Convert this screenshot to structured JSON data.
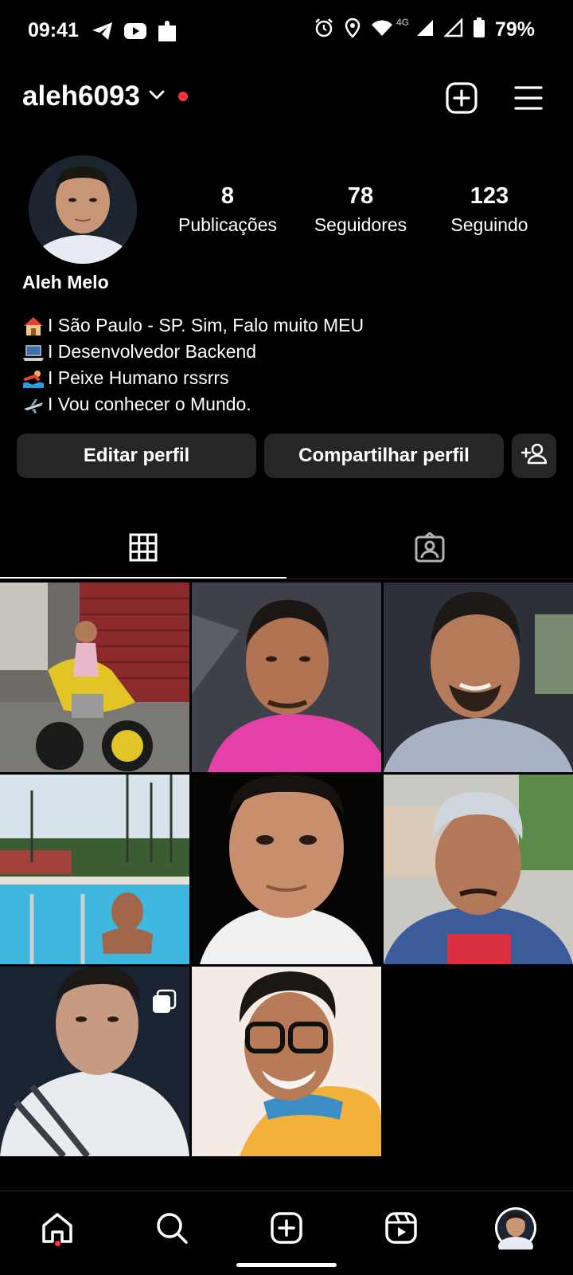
{
  "status_bar": {
    "time": "09:41",
    "network": "4G",
    "battery": "79%",
    "icons": [
      "telegram-icon",
      "youtube-icon",
      "puzzle-icon",
      "alarm-icon",
      "location-icon",
      "wifi-icon",
      "signal-icon",
      "battery-icon"
    ]
  },
  "header": {
    "username": "aleh6093",
    "icons": [
      "chevron-down-icon",
      "new-post-icon",
      "menu-icon"
    ]
  },
  "profile": {
    "display_name": "Aleh Melo",
    "stats": [
      {
        "count": "8",
        "label": "Publicações"
      },
      {
        "count": "78",
        "label": "Seguidores"
      },
      {
        "count": "123",
        "label": "Seguindo"
      }
    ],
    "bio": [
      {
        "icon": "house-emoji",
        "text": "I São Paulo - SP. Sim, Falo muito MEU"
      },
      {
        "icon": "laptop-emoji",
        "text": "I Desenvolvedor Backend"
      },
      {
        "icon": "swimmer-emoji",
        "text": " I Peixe Humano rssrrs"
      },
      {
        "icon": "airplane-emoji",
        "text": " I Vou conhecer o Mundo."
      }
    ]
  },
  "actions": {
    "edit_label": "Editar perfil",
    "share_label": "Compartilhar perfil",
    "discover_icon": "add-person-icon"
  },
  "tabs": [
    {
      "icon": "grid-icon",
      "selected": true
    },
    {
      "icon": "tagged-icon",
      "selected": false
    }
  ],
  "posts": [
    {
      "subject": "child on yellow motorcycle",
      "multiple": false
    },
    {
      "subject": "selfie pink shirt",
      "multiple": false
    },
    {
      "subject": "selfie in car",
      "multiple": false
    },
    {
      "subject": "man in swimming pool",
      "multiple": false
    },
    {
      "subject": "portrait white shirt",
      "multiple": false
    },
    {
      "subject": "selfie silver hair",
      "multiple": false
    },
    {
      "subject": "selfie striped shirt",
      "multiple": true
    },
    {
      "subject": "selfie with glasses",
      "multiple": false
    }
  ],
  "bottom_nav": [
    "home-icon",
    "search-icon",
    "create-icon",
    "reels-icon",
    "profile-avatar"
  ],
  "colors": {
    "background": "#000000",
    "button": "#262626",
    "notification": "#ff3040"
  }
}
